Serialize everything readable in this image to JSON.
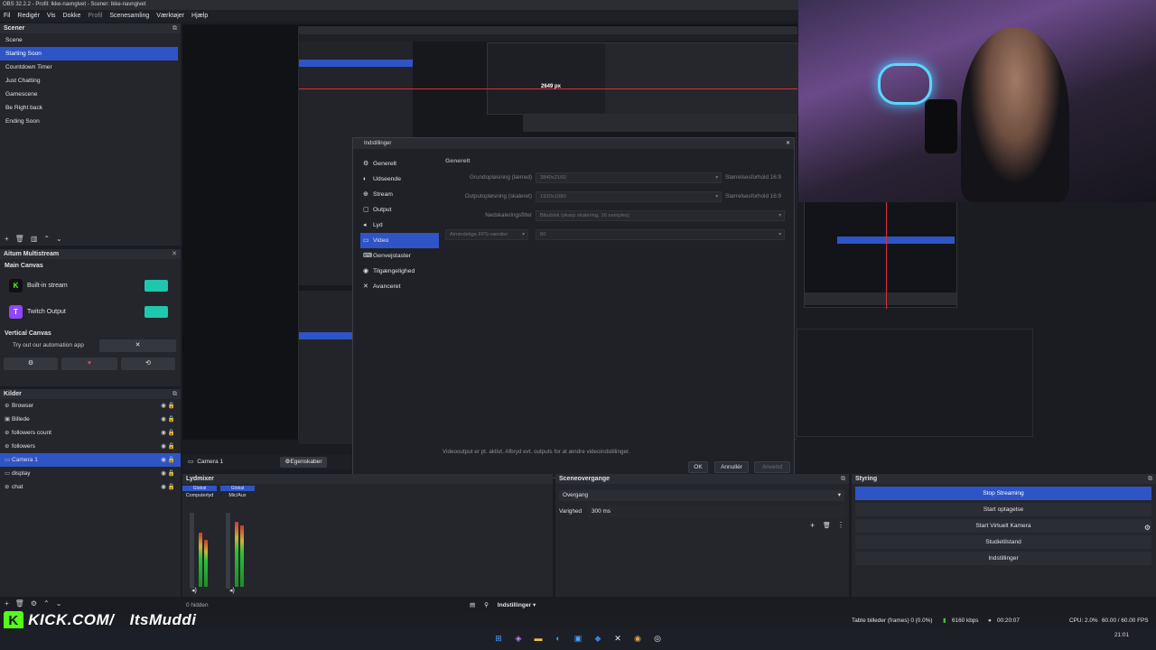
{
  "window": {
    "title": "OBS 32.2.2 - Profil: Ikke-navngivet - Scener: Ikke-navngivet"
  },
  "menu": [
    "Fil",
    "Redigér",
    "Vis",
    "Dokke",
    "Profil",
    "Scenesamling",
    "Værktøjer",
    "Hjælp"
  ],
  "scenes": {
    "title": "Scener",
    "items": [
      "Scene",
      "Starting Soon",
      "Countdown Timer",
      "Just Chatting",
      "Gamescene",
      "Be Right back",
      "Ending Soon"
    ],
    "selected_index": 1
  },
  "multistream": {
    "title": "Aitum Multistream",
    "main_canvas": "Main Canvas",
    "outputs": [
      {
        "name": "Built-in stream",
        "logo": "K",
        "color": "#53fc18"
      },
      {
        "name": "Twitch Output",
        "logo": "T",
        "color": "#9146ff"
      }
    ],
    "vertical_canvas": "Vertical Canvas",
    "vertical_label": "Try out our automation app"
  },
  "sources": {
    "title": "Kilder",
    "items": [
      {
        "name": "Browser",
        "icon": "globe-icon"
      },
      {
        "name": "Billede",
        "icon": "image-icon"
      },
      {
        "name": "followers count",
        "icon": "text-icon"
      },
      {
        "name": "followers",
        "icon": "globe-icon"
      },
      {
        "name": "Camera 1",
        "icon": "camera-icon"
      },
      {
        "name": "display",
        "icon": "monitor-icon"
      },
      {
        "name": "chat",
        "icon": "globe-icon"
      }
    ],
    "selected_index": 4
  },
  "source_toolbar": {
    "selected": "Camera 1",
    "properties": "Egenskaber"
  },
  "preview": {
    "measure": "2649 px"
  },
  "settings": {
    "title": "Indstillinger",
    "nav": [
      {
        "label": "Generelt",
        "icon": "gear-icon"
      },
      {
        "label": "Udseende",
        "icon": "palette-icon"
      },
      {
        "label": "Stream",
        "icon": "globe-icon"
      },
      {
        "label": "Output",
        "icon": "output-icon"
      },
      {
        "label": "Lyd",
        "icon": "speaker-icon"
      },
      {
        "label": "Video",
        "icon": "monitor-icon"
      },
      {
        "label": "Genvejstaster",
        "icon": "keyboard-icon"
      },
      {
        "label": "Tilgængelighed",
        "icon": "accessibility-icon"
      },
      {
        "label": "Avanceret",
        "icon": "tools-icon"
      }
    ],
    "selected_index": 5,
    "section": "Generelt",
    "base_res_label": "Grundopløsning (lærred)",
    "base_res_value": "3840x2160",
    "base_aspect": "Størrelsesforhold 16:9",
    "output_res_label": "Outputopløsning (skaleret)",
    "output_res_value": "1920x1080",
    "output_aspect": "Størrelsesforhold 16:9",
    "filter_label": "Nedskaleringsfilter",
    "filter_value": "Bikubisk (skarp skalering, 16 samples)",
    "fps_label": "Almindelige FPS-værdier",
    "fps_value": "60",
    "notice": "Videooutput er pt. aktivt. Afbryd evt. outputs for at ændre videoindstillinger.",
    "ok": "OK",
    "cancel": "Annullér",
    "apply": "Anvend"
  },
  "mixer": {
    "title": "Lydmixer",
    "channels": [
      {
        "scope": "Global",
        "name": "Computerlyd",
        "level": 0.55
      },
      {
        "scope": "Global",
        "name": "Mic/Aux",
        "level": 0.72
      }
    ],
    "hidden": "0 hidden"
  },
  "transitions": {
    "title": "Sceneovergange",
    "type": "Overgang",
    "duration_label": "Varighed",
    "duration_value": "300 ms"
  },
  "controls": {
    "title": "Styring",
    "buttons": [
      "Stop Streaming",
      "Start optagelse",
      "Start Virtuelt Kamera",
      "Studietilstand",
      "Indstillinger"
    ],
    "selected_index": 0
  },
  "bottom_bar": {
    "settings_label": "Indstillinger"
  },
  "status": {
    "dropped": "Tabte billeder (frames) 0 (0.0%)",
    "bitrate": "6160 kbps",
    "time": "00:20:07",
    "cpu": "CPU: 2.0%",
    "fps": "60.00 / 60.00 FPS"
  },
  "overlay": {
    "brand": "KICK.COM/",
    "handle": "ItsMuddi"
  },
  "taskbar": {
    "clock": "21:01"
  },
  "colors": {
    "accent": "#2f54c6",
    "toggle": "#1fc7ad",
    "kick": "#53fc18",
    "twitch": "#9146ff"
  }
}
